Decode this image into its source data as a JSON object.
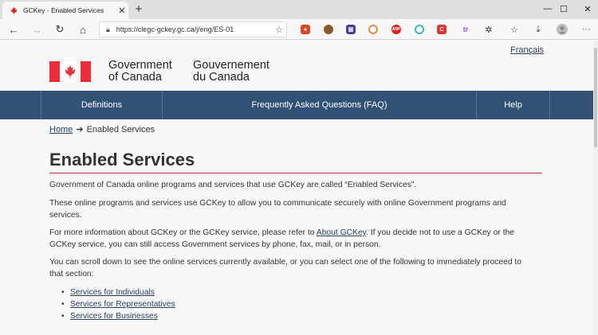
{
  "browser": {
    "tab_title": "GCKey - Enabled Services",
    "url": "https://clegc-gckey.gc.ca/j/eng/ES-01"
  },
  "header": {
    "language_toggle": "Français",
    "signature_en_line1": "Government",
    "signature_en_line2": "of Canada",
    "signature_fr_line1": "Gouvernement",
    "signature_fr_line2": "du Canada"
  },
  "menu": {
    "items": [
      {
        "label": "Definitions"
      },
      {
        "label": "Frequently Asked Questions (FAQ)"
      },
      {
        "label": "Help"
      }
    ]
  },
  "breadcrumb": {
    "home": "Home",
    "current": "Enabled Services"
  },
  "main": {
    "title": "Enabled Services",
    "p1": "Government of Canada online programs and services that use GCKey are called “Enabled Services”.",
    "p2": "These online programs and services use GCKey to allow you to communicate securely with online Government programs and services.",
    "p3_before": "For more information about GCKey or the GCKey service, please refer to ",
    "p3_link": "About GCKey",
    "p3_after": ". If you decide not to use a GCKey or the GCKey service, you can still access Government services by phone, fax, mail, or in person.",
    "p4": "You can scroll down to see the online services currently available, or you can select one of the following to immediately proceed to that section:",
    "links": [
      {
        "label": "Services for Individuals"
      },
      {
        "label": "Services for Representatives"
      },
      {
        "label": "Services for Businesses"
      }
    ]
  },
  "colors": {
    "menu_bg": "#335075",
    "link": "#284162",
    "flag_red": "#eb2d37",
    "title_rule": "#af3c43"
  }
}
